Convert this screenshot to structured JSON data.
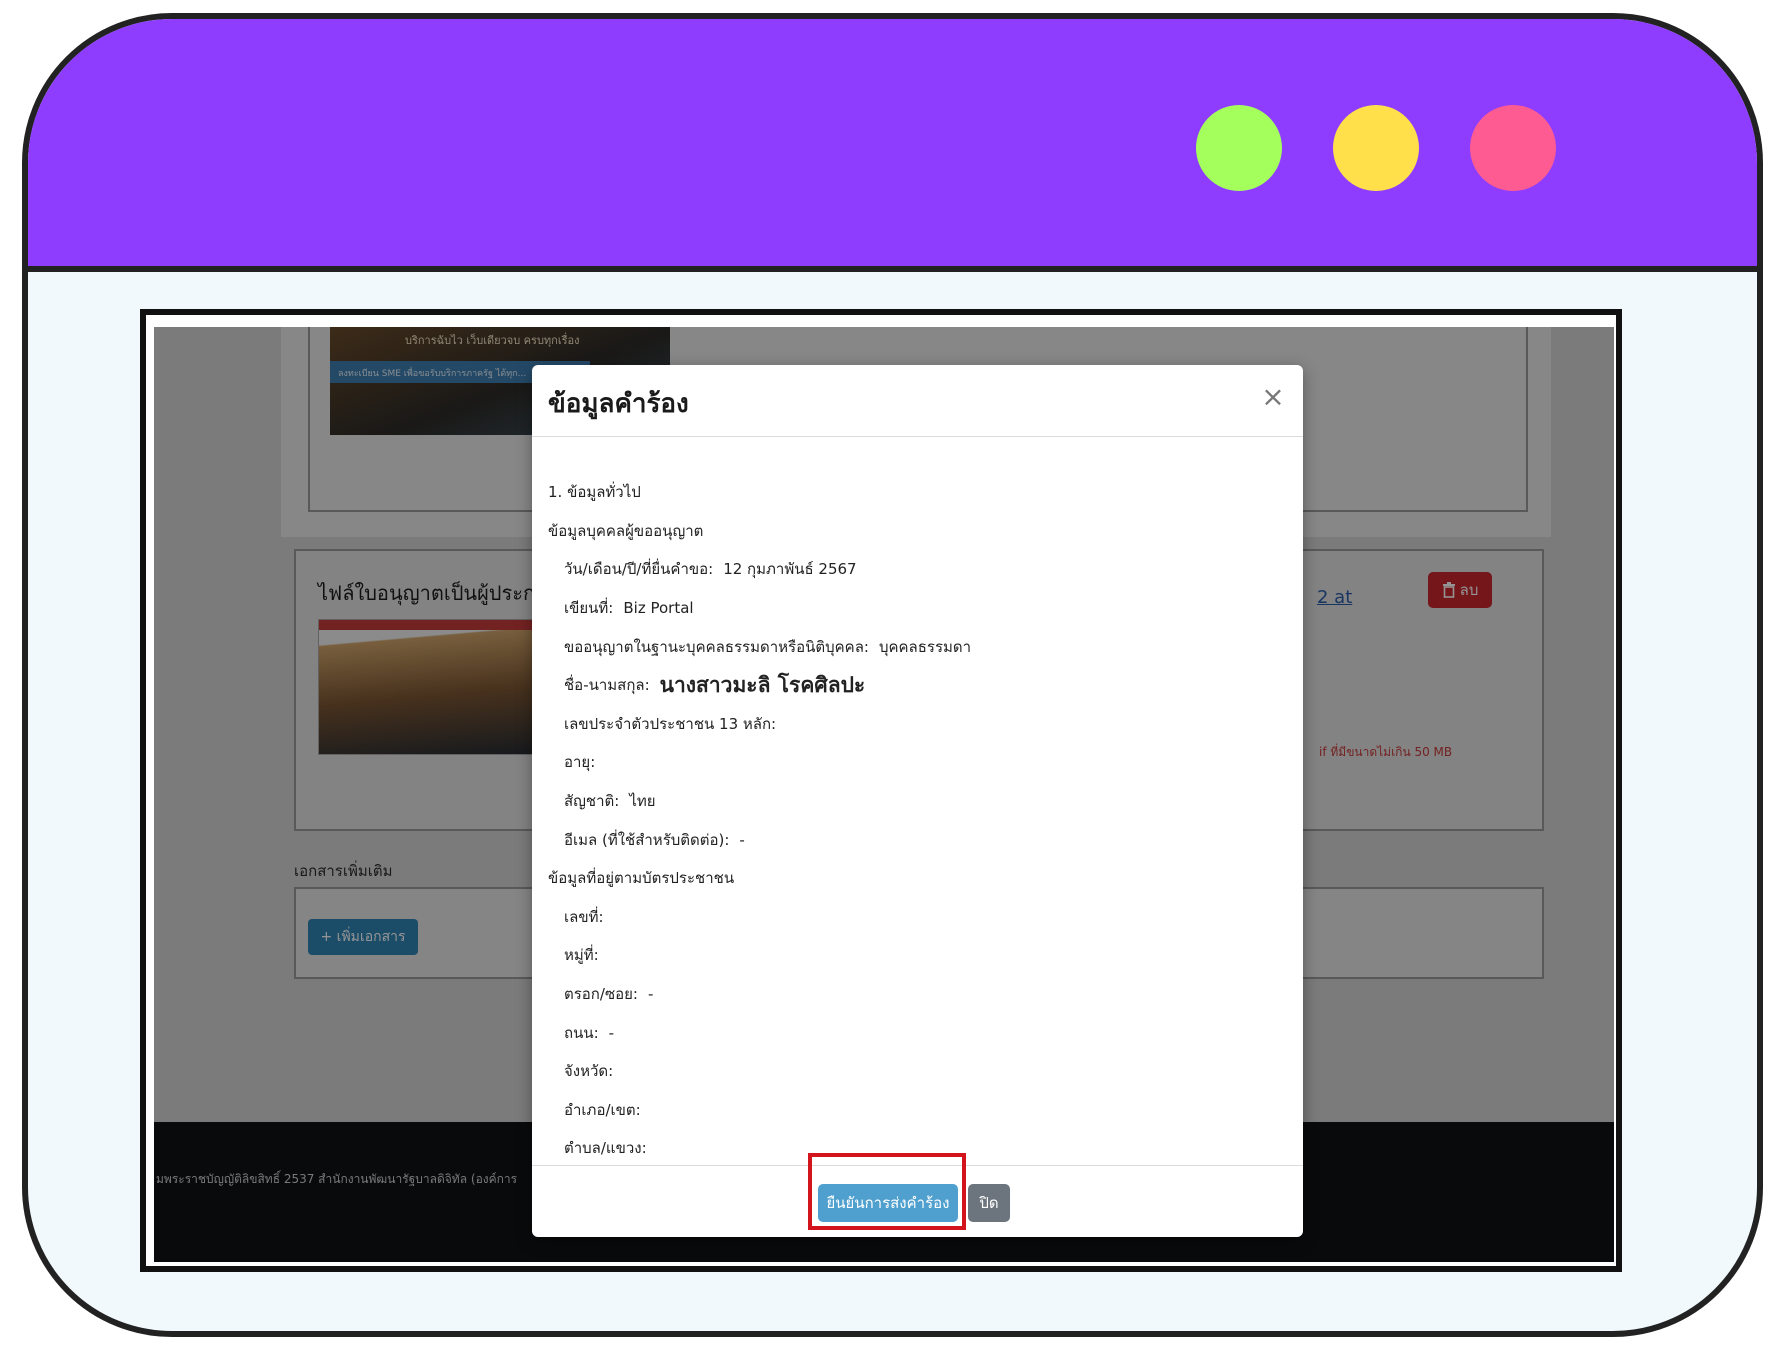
{
  "colors": {
    "frame_bar": "#8e3dff",
    "dot_green": "#a4ff5d",
    "dot_yellow": "#ffe04b",
    "dot_pink": "#ff5b93",
    "highlight": "#d4141d",
    "confirm_button": "#4fa0cf",
    "delete_button": "#c8262e"
  },
  "background": {
    "banner_text": "บริการฉับไว เว็บเดียวจบ ครบทุกเรื่อง",
    "banner_strip_text": "ลงทะเบียน SME เพื่อขอรับบริการภาครัฐ ได้ทุก...",
    "file_card_title": "ไฟล์ใบอนุญาตเป็นผู้ประกอบ",
    "file_link": "2 at",
    "delete_label": "ลบ",
    "file_note": "if ที่มีขนาดไม่เกิน 50 MB",
    "extra_docs_label": "เอกสารเพิ่มเติม",
    "add_doc_label": "+ เพิ่มเอกสาร",
    "footer_text": "มพระราชบัญญัติลิขสิทธิ์ 2537 สำนักงานพัฒนารัฐบาลดิจิทัล (องค์การ"
  },
  "modal": {
    "title": "ข้อมูลคำร้อง",
    "close_icon": "close-icon",
    "section_general": "1. ข้อมูลทั่วไป",
    "section_applicant": "ข้อมูลบุคคลผู้ขออนุญาต",
    "fields": {
      "submit_date_label": "วัน/เดือน/ปี/ที่ยื่นคำขอ:",
      "submit_date_value": "12 กุมภาพันธ์ 2567",
      "written_at_label": "เขียนที่:",
      "written_at_value": "Biz Portal",
      "person_type_label": "ขออนุญาตในฐานะบุคคลธรรมดาหรือนิติบุคคล:",
      "person_type_value": "บุคคลธรรมดา",
      "name_label": "ชื่อ-นามสกุล:",
      "name_value": "นางสาวมะลิ โรคศิลปะ",
      "id_label": "เลขประจำตัวประชาชน 13 หลัก:",
      "age_label": "อายุ:",
      "nationality_label": "สัญชาติ:",
      "nationality_value": "ไทย",
      "email_label": "อีเมล (ที่ใช้สำหรับติดต่อ):",
      "email_value": "-"
    },
    "section_address": "ข้อมูลที่อยู่ตามบัตรประชาชน",
    "address": {
      "house_no_label": "เลขที่:",
      "moo_label": "หมู่ที่:",
      "soi_label": "ตรอก/ซอย:",
      "soi_value": "-",
      "road_label": "ถนน:",
      "road_value": "-",
      "province_label": "จังหวัด:",
      "district_label": "อำเภอ/เขต:",
      "subdistrict_label": "ตำบล/แขวง:"
    },
    "confirm_label": "ยืนยันการส่งคำร้อง",
    "close_label": "ปิด"
  }
}
